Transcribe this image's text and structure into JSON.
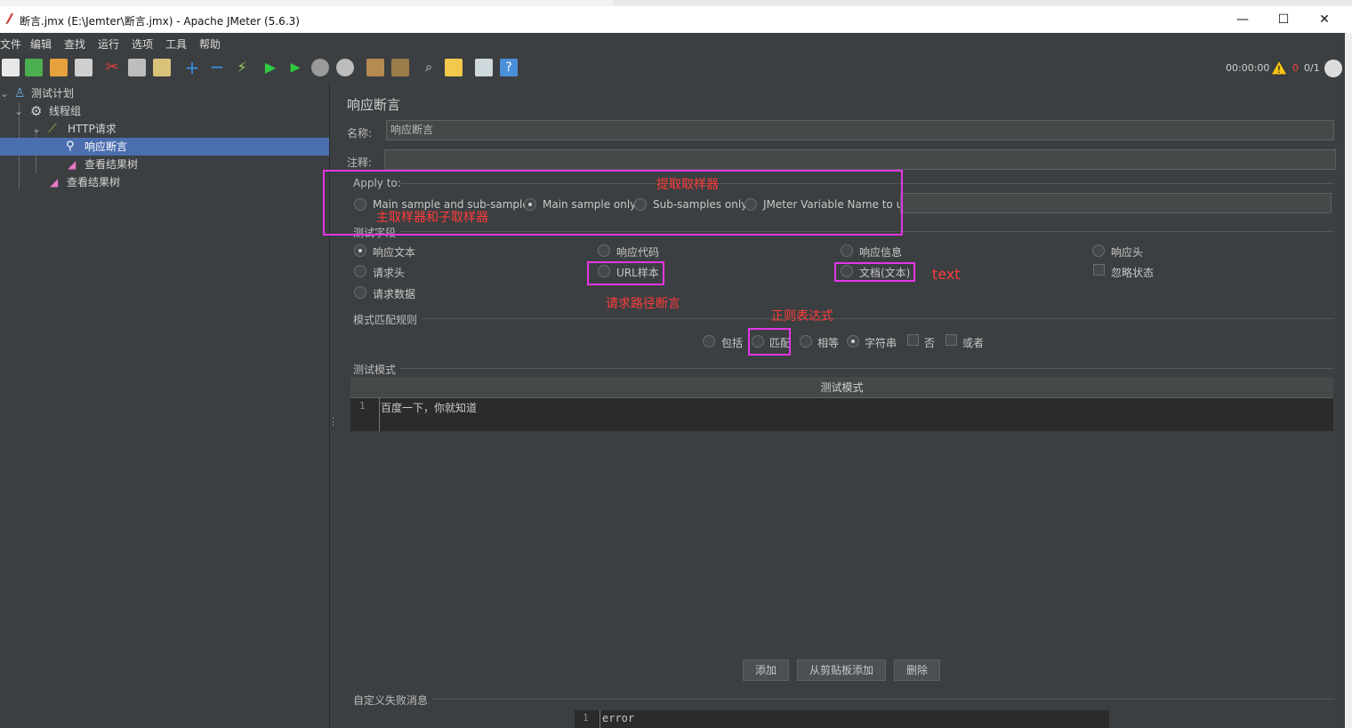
{
  "window": {
    "title": "断言.jmx (E:\\Jemter\\断言.jmx) - Apache JMeter (5.6.3)",
    "minimize": "—",
    "maximize": "☐",
    "close": "✕"
  },
  "menu": [
    "文件",
    "编辑",
    "查找",
    "运行",
    "选项",
    "工具",
    "帮助"
  ],
  "status": {
    "timer": "00:00:00",
    "warn_count": "0",
    "threads": "0/1"
  },
  "tree": {
    "items": [
      {
        "label": "测试计划",
        "icon": "test-plan-icon"
      },
      {
        "label": "线程组",
        "icon": "gear-icon"
      },
      {
        "label": "HTTP请求",
        "icon": "pipette-icon"
      },
      {
        "label": "响应断言",
        "icon": "assertion-icon"
      },
      {
        "label": "查看结果树",
        "icon": "chart-icon"
      },
      {
        "label": "查看结果树",
        "icon": "chart-icon"
      }
    ]
  },
  "panel": {
    "heading": "响应断言",
    "name_label": "名称:",
    "name_value": "响应断言",
    "comment_label": "注释:",
    "comment_value": "",
    "apply_to": {
      "label": "Apply to:",
      "options": [
        "Main sample and sub-samples",
        "Main sample only",
        "Sub-samples only",
        "JMeter Variable Name to use"
      ],
      "selected": 1
    },
    "test_field": {
      "label": "测试字段",
      "options": [
        "响应文本",
        "响应代码",
        "响应信息",
        "响应头",
        "请求头",
        "URL样本",
        "文档(文本)",
        "忽略状态",
        "请求数据"
      ],
      "selected": 0
    },
    "pattern_rules": {
      "label": "模式匹配规则",
      "options": [
        "包括",
        "匹配",
        "相等",
        "字符串",
        "否",
        "或者"
      ],
      "selected": 3
    },
    "test_patterns": {
      "label": "测试模式",
      "column_header": "测试模式",
      "rows": [
        "百度一下，你就知道"
      ]
    },
    "buttons": {
      "add": "添加",
      "add_clipboard": "从剪贴板添加",
      "delete": "删除"
    },
    "custom_failure": {
      "label": "自定义失败消息",
      "value": "error"
    }
  },
  "annotations": {
    "extract_sampler": "提取取样器",
    "main_and_sub": "主取样器和子取样器",
    "text": "text",
    "url_assert": "请求路径断言",
    "regex": "正则表达式"
  },
  "colors": {
    "background": "#3c3f41",
    "selection": "#4b6eaf",
    "highlight": "#e535e5",
    "note": "#ff3b3b"
  }
}
